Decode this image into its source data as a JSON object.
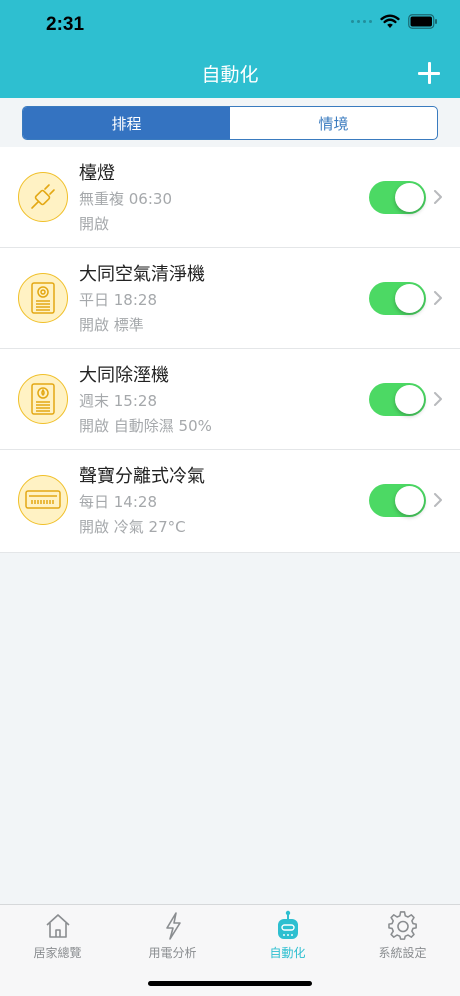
{
  "status_bar": {
    "time": "2:31"
  },
  "header": {
    "title": "自動化",
    "add_icon": "plus-icon"
  },
  "segments": [
    {
      "label": "排程",
      "active": true
    },
    {
      "label": "情境",
      "active": false
    }
  ],
  "schedules": [
    {
      "name": "檯燈",
      "time": "無重複 06:30",
      "action": "開啟",
      "enabled": true,
      "icon": "plug-icon"
    },
    {
      "name": "大同空氣清淨機",
      "time": "平日 18:28",
      "action": "開啟 標準",
      "enabled": true,
      "icon": "air-purifier-icon"
    },
    {
      "name": "大同除溼機",
      "time": "週末 15:28",
      "action": "開啟 自動除濕 50%",
      "enabled": true,
      "icon": "dehumidifier-icon"
    },
    {
      "name": "聲寶分離式冷氣",
      "time": "每日 14:28",
      "action": "開啟 冷氣 27°C",
      "enabled": true,
      "icon": "air-conditioner-icon"
    }
  ],
  "tabbar": [
    {
      "label": "居家總覽",
      "icon": "home-icon",
      "active": false
    },
    {
      "label": "用電分析",
      "icon": "lightning-icon",
      "active": false
    },
    {
      "label": "自動化",
      "icon": "robot-icon",
      "active": true
    },
    {
      "label": "系統設定",
      "icon": "gear-icon",
      "active": false
    }
  ],
  "colors": {
    "header": "#2ebfd0",
    "segment_active": "#3473c1",
    "toggle_on": "#4cd964",
    "device_icon_bg": "#fff2c4",
    "device_icon_border": "#f0c02a",
    "tab_active": "#2ebfd0"
  }
}
